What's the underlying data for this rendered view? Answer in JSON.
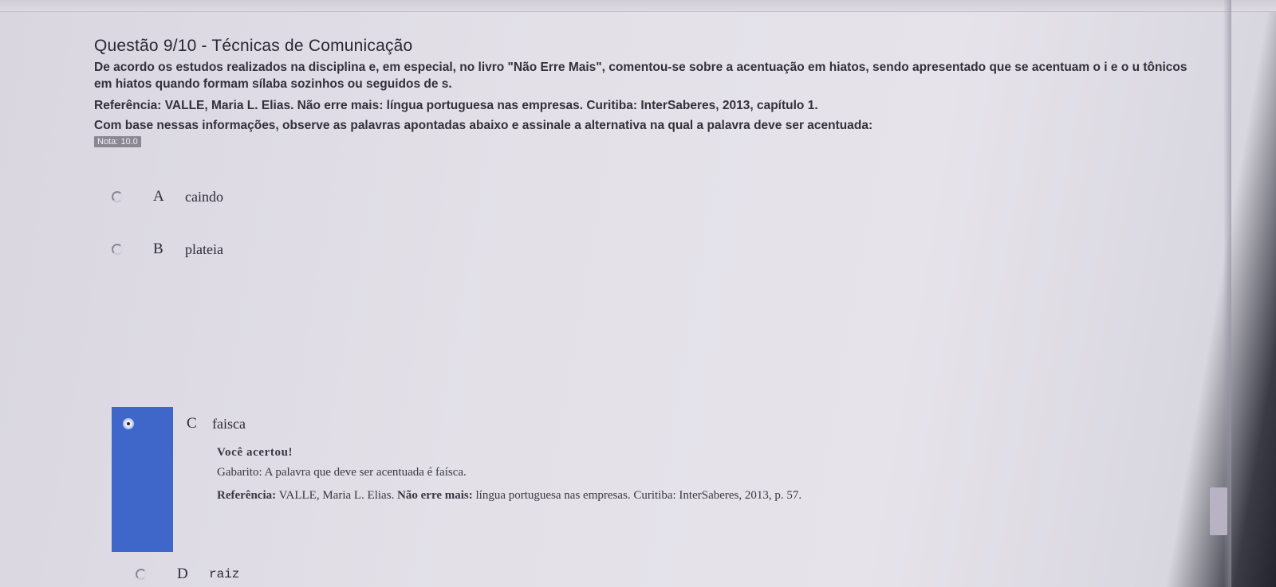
{
  "question": {
    "title": "Questão 9/10 - Técnicas de Comunicação",
    "text": "De acordo os estudos realizados na disciplina e, em especial, no livro \"Não Erre Mais\", comentou-se sobre a acentuação em hiatos, sendo apresentado que se acentuam o i e o u tônicos em hiatos quando formam sílaba sozinhos ou seguidos de s.",
    "reference": "Referência: VALLE, Maria L. Elias. Não erre mais: língua portuguesa nas empresas. Curitiba: InterSaberes, 2013, capítulo 1.",
    "prompt": "Com base nessas informações, observe as palavras apontadas abaixo e assinale a alternativa na qual a palavra deve ser acentuada:",
    "grade": "Nota: 10.0"
  },
  "options": [
    {
      "letter": "A",
      "text": "caindo",
      "selected": false
    },
    {
      "letter": "B",
      "text": "plateia",
      "selected": false
    },
    {
      "letter": "C",
      "text": "faisca",
      "selected": true
    },
    {
      "letter": "D",
      "text": "raiz",
      "selected": false
    }
  ],
  "feedback": {
    "title": "Você acertou!",
    "answer": "Gabarito: A palavra que deve ser acentuada é faísca.",
    "reference_label": "Referência:",
    "reference_text": " VALLE, Maria L. Elias. ",
    "reference_book": "Não erre mais:",
    "reference_rest": " língua portuguesa nas empresas. Curitiba: InterSaberes, 2013, p. 57."
  },
  "colors": {
    "selected_bar": "#3f66c9",
    "background": "#e3e0e8"
  }
}
